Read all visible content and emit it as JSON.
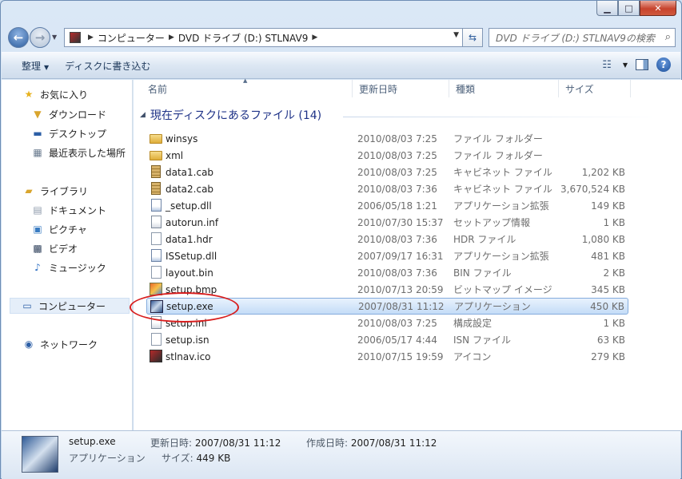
{
  "window": {
    "minimize": "▁",
    "maximize": "□",
    "close": "✕"
  },
  "address": {
    "crumbs": [
      "コンピューター",
      "DVD ドライブ (D:) STLNAV9"
    ],
    "search_placeholder": "DVD ドライブ (D:) STLNAV9の検索"
  },
  "toolbar": {
    "organize": "整理",
    "burn": "ディスクに書き込む"
  },
  "nav": {
    "favorites": "お気に入り",
    "downloads": "ダウンロード",
    "desktop": "デスクトップ",
    "recent": "最近表示した場所",
    "libraries": "ライブラリ",
    "documents": "ドキュメント",
    "pictures": "ピクチャ",
    "videos": "ビデオ",
    "music": "ミュージック",
    "computer": "コンピューター",
    "network": "ネットワーク"
  },
  "columns": {
    "name": "名前",
    "modified": "更新日時",
    "type": "種類",
    "size": "サイズ"
  },
  "group": {
    "title": "現在ディスクにあるファイル (14)"
  },
  "files": [
    {
      "name": "winsys",
      "date": "2010/08/03 7:25",
      "type": "ファイル フォルダー",
      "size": "",
      "icon": "folder-icon"
    },
    {
      "name": "xml",
      "date": "2010/08/03 7:25",
      "type": "ファイル フォルダー",
      "size": "",
      "icon": "folder-icon"
    },
    {
      "name": "data1.cab",
      "date": "2010/08/03 7:25",
      "type": "キャビネット ファイル",
      "size": "1,202 KB",
      "icon": "cab-file-icon"
    },
    {
      "name": "data2.cab",
      "date": "2010/08/03 7:36",
      "type": "キャビネット ファイル",
      "size": "3,670,524 KB",
      "icon": "cab-file-icon"
    },
    {
      "name": "_setup.dll",
      "date": "2006/05/18 1:21",
      "type": "アプリケーション拡張",
      "size": "149 KB",
      "icon": "dll-file-icon"
    },
    {
      "name": "autorun.inf",
      "date": "2010/07/30 15:37",
      "type": "セットアップ情報",
      "size": "1 KB",
      "icon": "inf-file-icon"
    },
    {
      "name": "data1.hdr",
      "date": "2010/08/03 7:36",
      "type": "HDR ファイル",
      "size": "1,080 KB",
      "icon": "blank-file-icon"
    },
    {
      "name": "ISSetup.dll",
      "date": "2007/09/17 16:31",
      "type": "アプリケーション拡張",
      "size": "481 KB",
      "icon": "dll-file-icon"
    },
    {
      "name": "layout.bin",
      "date": "2010/08/03 7:36",
      "type": "BIN ファイル",
      "size": "2 KB",
      "icon": "blank-file-icon"
    },
    {
      "name": "setup.bmp",
      "date": "2010/07/13 20:59",
      "type": "ビットマップ イメージ",
      "size": "345 KB",
      "icon": "bitmap-file-icon"
    },
    {
      "name": "setup.exe",
      "date": "2007/08/31 11:12",
      "type": "アプリケーション",
      "size": "450 KB",
      "icon": "setup-exe-icon"
    },
    {
      "name": "setup.ini",
      "date": "2010/08/03 7:25",
      "type": "構成設定",
      "size": "1 KB",
      "icon": "ini-file-icon"
    },
    {
      "name": "setup.isn",
      "date": "2006/05/17 4:44",
      "type": "ISN ファイル",
      "size": "63 KB",
      "icon": "blank-file-icon"
    },
    {
      "name": "stlnav.ico",
      "date": "2010/07/15 19:59",
      "type": "アイコン",
      "size": "279 KB",
      "icon": "ico-file-icon"
    }
  ],
  "details": {
    "name": "setup.exe",
    "type": "アプリケーション",
    "modified_label": "更新日時:",
    "modified_value": "2007/08/31 11:12",
    "created_label": "作成日時:",
    "created_value": "2007/08/31 11:12",
    "size_label": "サイズ:",
    "size_value": "449 KB"
  },
  "colors": {
    "highlight_ring": "#d81e1e",
    "group_title": "#1e3287",
    "selection": "#c4dcf7"
  }
}
